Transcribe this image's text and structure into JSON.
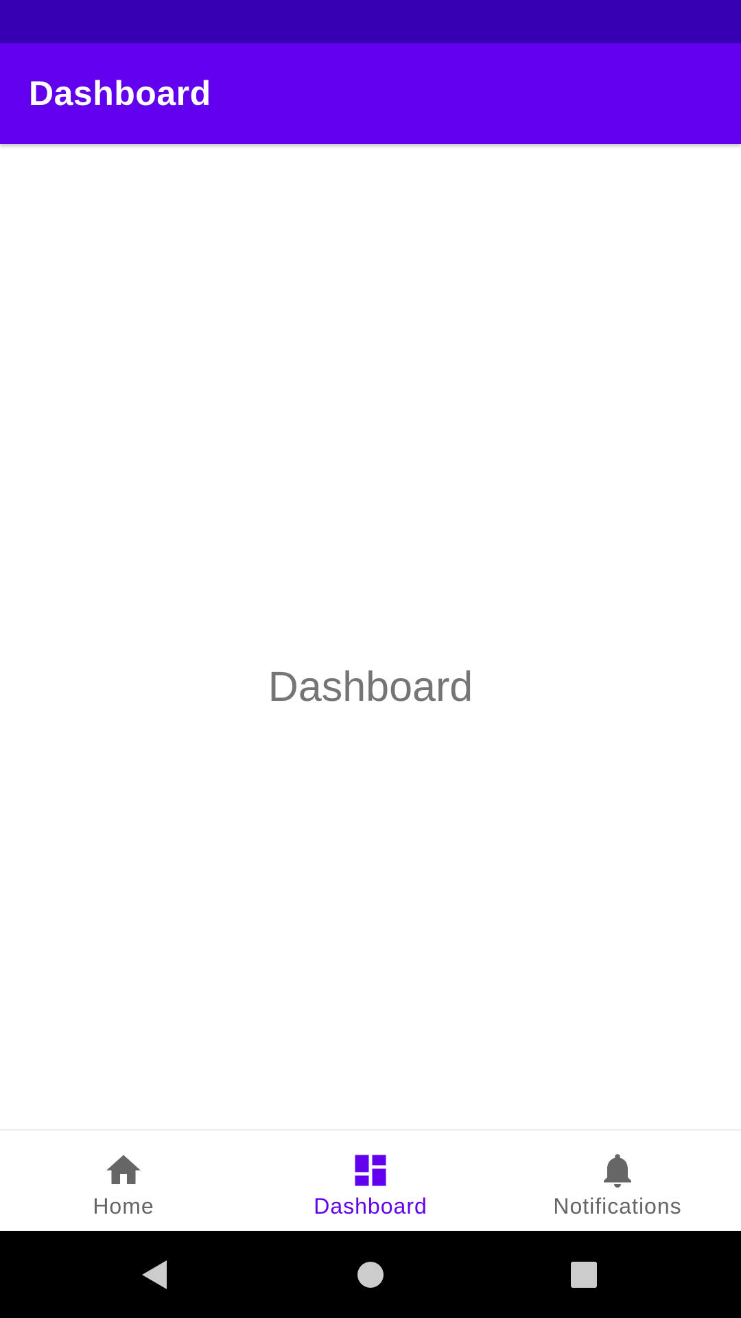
{
  "app_bar": {
    "title": "Dashboard"
  },
  "main": {
    "center_text": "Dashboard"
  },
  "bottom_nav": {
    "items": [
      {
        "label": "Home",
        "icon": "home-icon",
        "active": false
      },
      {
        "label": "Dashboard",
        "icon": "dashboard-icon",
        "active": true
      },
      {
        "label": "Notifications",
        "icon": "bell-icon",
        "active": false
      }
    ]
  },
  "system_nav": {
    "buttons": [
      "back-icon",
      "home-circle-icon",
      "recents-square-icon"
    ]
  },
  "colors": {
    "status_bar": "#3700b3",
    "primary": "#6200ee",
    "inactive_icon": "#666666",
    "center_text": "#757575",
    "system_nav_bg": "#000000",
    "system_nav_icons": "#cccccc"
  }
}
